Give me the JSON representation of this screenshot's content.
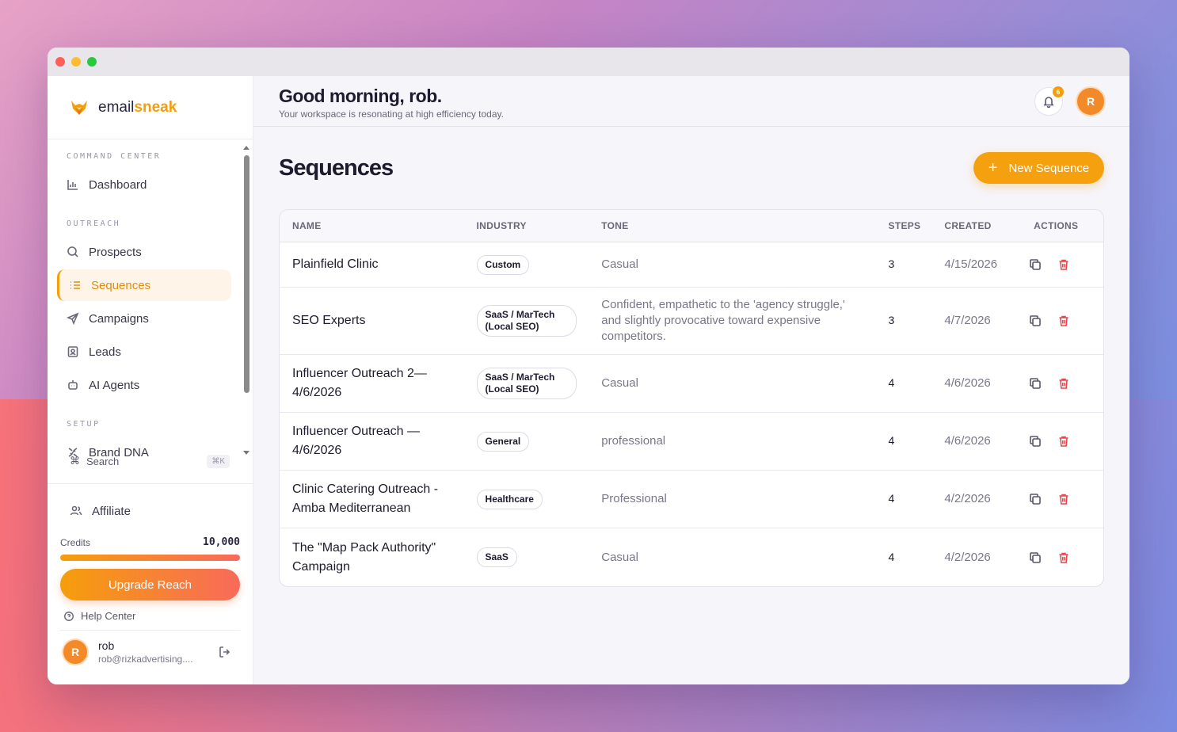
{
  "brand": {
    "name_prefix": "email",
    "name_accent": "sneak"
  },
  "sidebar": {
    "sections": [
      {
        "title": "COMMAND CENTER",
        "items": [
          {
            "label": "Dashboard",
            "icon": "bar-chart-icon"
          }
        ]
      },
      {
        "title": "OUTREACH",
        "items": [
          {
            "label": "Prospects",
            "icon": "search-icon"
          },
          {
            "label": "Sequences",
            "icon": "list-icon",
            "active": true
          },
          {
            "label": "Campaigns",
            "icon": "send-icon"
          },
          {
            "label": "Leads",
            "icon": "contact-icon"
          },
          {
            "label": "AI Agents",
            "icon": "robot-icon"
          }
        ]
      },
      {
        "title": "SETUP",
        "items": [
          {
            "label": "Brand DNA",
            "icon": "dna-icon"
          }
        ]
      }
    ],
    "search": {
      "label": "Search",
      "shortcut": "⌘K"
    },
    "affiliate": "Affiliate",
    "credits": {
      "label": "Credits",
      "value": "10,000",
      "fill_fraction": 1.0
    },
    "upgrade_label": "Upgrade Reach",
    "help_label": "Help Center",
    "user": {
      "initial": "R",
      "name": "rob",
      "email": "rob@rizkadvertising...."
    }
  },
  "header": {
    "greeting": "Good morning, rob.",
    "subtitle": "Your workspace is resonating at high efficiency today.",
    "notification_count": "6",
    "avatar_initial": "R"
  },
  "page": {
    "title": "Sequences",
    "new_button_label": "New Sequence",
    "plus_glyph": "+"
  },
  "table": {
    "columns": {
      "name": "NAME",
      "industry": "INDUSTRY",
      "tone": "TONE",
      "steps": "STEPS",
      "created": "CREATED",
      "actions": "ACTIONS"
    },
    "rows": [
      {
        "name": "Plainfield Clinic",
        "industry": "Custom",
        "tone": "Casual",
        "steps": "3",
        "created": "4/15/2026"
      },
      {
        "name": "SEO Experts",
        "industry": "SaaS / MarTech (Local SEO)",
        "tone": "Confident, empathetic to the 'agency struggle,' and slightly provocative toward expensive competitors.",
        "steps": "3",
        "created": "4/7/2026"
      },
      {
        "name": "Influencer Outreach 2—4/6/2026",
        "industry": "SaaS / MarTech (Local SEO)",
        "tone": "Casual",
        "steps": "4",
        "created": "4/6/2026"
      },
      {
        "name": "Influencer Outreach — 4/6/2026",
        "industry": "General",
        "tone": "professional",
        "steps": "4",
        "created": "4/6/2026"
      },
      {
        "name": "Clinic Catering Outreach - Amba Mediterranean",
        "industry": "Healthcare",
        "tone": "Professional",
        "steps": "4",
        "created": "4/2/2026"
      },
      {
        "name": "The \"Map Pack Authority\" Campaign",
        "industry": "SaaS",
        "tone": "Casual",
        "steps": "4",
        "created": "4/2/2026"
      }
    ]
  },
  "colors": {
    "accent": "#f59e0b",
    "danger": "#e5484d",
    "active_bg": "#fef5e8"
  }
}
